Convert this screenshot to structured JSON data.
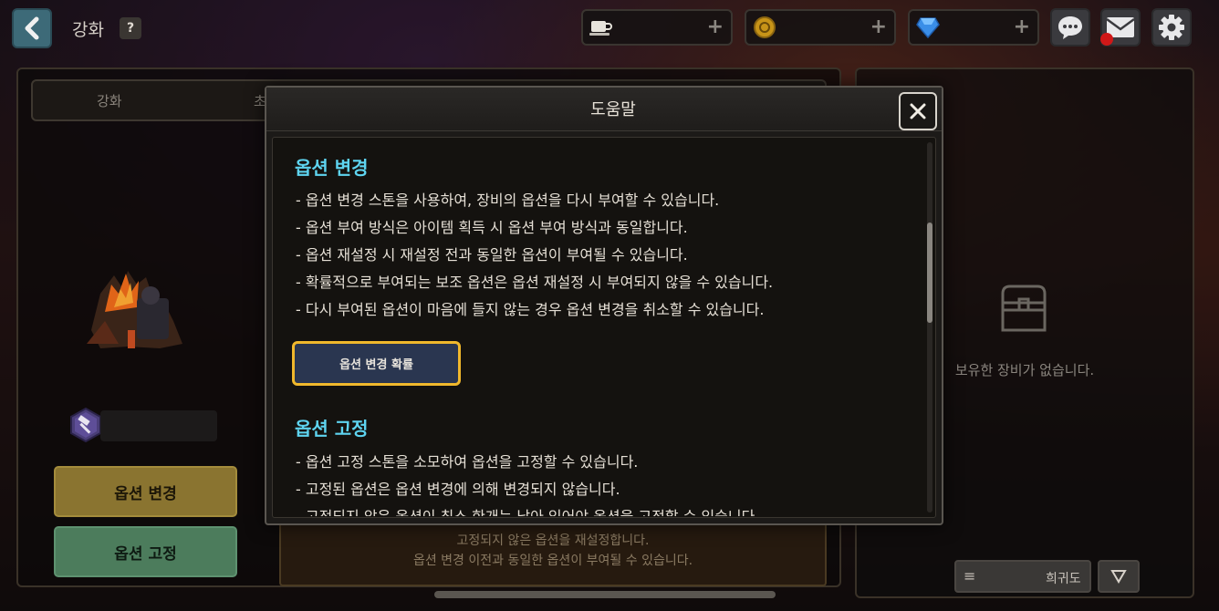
{
  "header": {
    "title": "강화",
    "help_label": "?",
    "currencies": [
      {
        "icon": "coffee-icon",
        "plus": "+"
      },
      {
        "icon": "gold-coin-icon",
        "plus": "+"
      },
      {
        "icon": "diamond-gem-icon",
        "plus": "+"
      }
    ]
  },
  "tabs": [
    {
      "label": "강화"
    },
    {
      "label": "초"
    }
  ],
  "left": {
    "change_button": "옵션 변경",
    "fix_button": "옵션 고정",
    "info_lines": [
      "고정되지 않은 옵션을 재설정합니다.",
      "옵션 변경 이전과 동일한 옵션이 부여될 수 있습니다."
    ]
  },
  "right": {
    "empty_text": "보유한 장비가 없습니다.",
    "sort_label": "희귀도",
    "sort_lines": "≡"
  },
  "modal": {
    "title": "도움말",
    "sections": [
      {
        "heading": "옵션 변경",
        "lines": [
          "- 옵션 변경 스톤을 사용하여, 장비의 옵션을 다시 부여할 수 있습니다.",
          "- 옵션 부여 방식은 아이템 획득 시 옵션 부여 방식과 동일합니다.",
          "- 옵션 재설정 시 재설정 전과 동일한 옵션이 부여될 수 있습니다.",
          "- 확률적으로 부여되는 보조 옵션은 옵션 재설정 시 부여되지 않을 수 있습니다.",
          "- 다시 부여된 옵션이 마음에 들지 않는 경우 옵션 변경을 취소할 수 있습니다."
        ],
        "button": "옵션 변경 확률"
      },
      {
        "heading": "옵션 고정",
        "lines": [
          "- 옵션 고정 스톤을 소모하여 옵션을 고정할 수 있습니다.",
          "- 고정된 옵션은 옵션 변경에 의해 변경되지 않습니다.",
          "- 고정되지 않은 옵션이 최소 한개는 남아 있어야 옵션을 고정할 수 있습니다."
        ]
      }
    ]
  },
  "colors": {
    "heading": "#5ed4f0",
    "highlight_border": "#f0b82c",
    "change_button": "#8a7430",
    "fix_button": "#4c7c5c"
  }
}
